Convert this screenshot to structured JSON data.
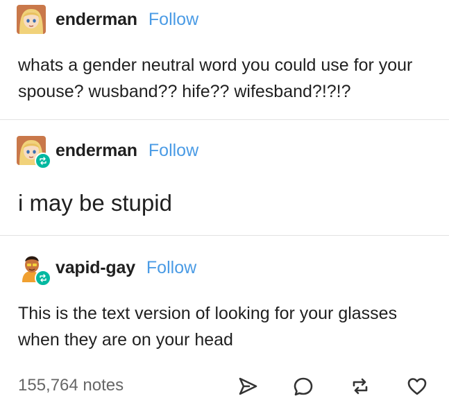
{
  "posts": [
    {
      "username": "enderman",
      "follow_label": "Follow",
      "avatar_icon": "anime-avatar-blonde",
      "reblogged": false,
      "text": "whats a gender neutral word you could use for your spouse? wusband?? hife?? wifesband?!?!?"
    },
    {
      "username": "enderman",
      "follow_label": "Follow",
      "avatar_icon": "anime-avatar-blonde",
      "reblogged": true,
      "text": "i may be stupid"
    },
    {
      "username": "vapid-gay",
      "follow_label": "Follow",
      "avatar_icon": "cartoon-avatar",
      "reblogged": true,
      "text": "This is the text version of looking for your glasses when they are on your head"
    }
  ],
  "footer": {
    "notes": "155,764 notes",
    "actions": [
      "share-icon",
      "reply-icon",
      "reblog-icon",
      "like-icon"
    ]
  },
  "colors": {
    "follow": "#4a9be5",
    "reblog_badge": "#00b8a0",
    "divider": "#e2e2e2",
    "notes": "#666666"
  }
}
